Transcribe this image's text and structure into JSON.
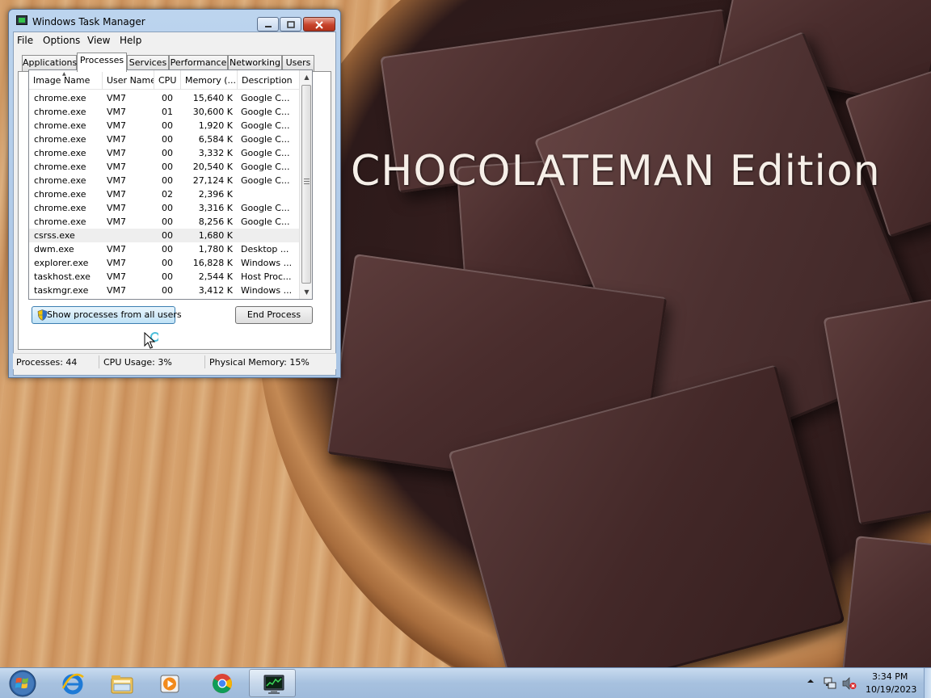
{
  "wallpaper": {
    "title": "CHOCOLATEMAN Edition"
  },
  "window": {
    "title": "Windows Task Manager",
    "menus": [
      "File",
      "Options",
      "View",
      "Help"
    ],
    "tabs": [
      "Applications",
      "Processes",
      "Services",
      "Performance",
      "Networking",
      "Users"
    ],
    "active_tab": "Processes",
    "columns": [
      "Image Name",
      "User Name",
      "CPU",
      "Memory (...",
      "Description"
    ],
    "processes": [
      {
        "name": "chrome.exe",
        "user": "VM7",
        "cpu": "00",
        "mem": "15,640 K",
        "desc": "Google C..."
      },
      {
        "name": "chrome.exe",
        "user": "VM7",
        "cpu": "01",
        "mem": "30,600 K",
        "desc": "Google C..."
      },
      {
        "name": "chrome.exe",
        "user": "VM7",
        "cpu": "00",
        "mem": "1,920 K",
        "desc": "Google C..."
      },
      {
        "name": "chrome.exe",
        "user": "VM7",
        "cpu": "00",
        "mem": "6,584 K",
        "desc": "Google C..."
      },
      {
        "name": "chrome.exe",
        "user": "VM7",
        "cpu": "00",
        "mem": "3,332 K",
        "desc": "Google C..."
      },
      {
        "name": "chrome.exe",
        "user": "VM7",
        "cpu": "00",
        "mem": "20,540 K",
        "desc": "Google C..."
      },
      {
        "name": "chrome.exe",
        "user": "VM7",
        "cpu": "00",
        "mem": "27,124 K",
        "desc": "Google C..."
      },
      {
        "name": "chrome.exe",
        "user": "VM7",
        "cpu": "02",
        "mem": "2,396 K",
        "desc": ""
      },
      {
        "name": "chrome.exe",
        "user": "VM7",
        "cpu": "00",
        "mem": "3,316 K",
        "desc": "Google C..."
      },
      {
        "name": "chrome.exe",
        "user": "VM7",
        "cpu": "00",
        "mem": "8,256 K",
        "desc": "Google C..."
      },
      {
        "name": "csrss.exe",
        "user": "",
        "cpu": "00",
        "mem": "1,680 K",
        "desc": ""
      },
      {
        "name": "dwm.exe",
        "user": "VM7",
        "cpu": "00",
        "mem": "1,780 K",
        "desc": "Desktop ..."
      },
      {
        "name": "explorer.exe",
        "user": "VM7",
        "cpu": "00",
        "mem": "16,828 K",
        "desc": "Windows ..."
      },
      {
        "name": "taskhost.exe",
        "user": "VM7",
        "cpu": "00",
        "mem": "2,544 K",
        "desc": "Host Proc..."
      },
      {
        "name": "taskmgr.exe",
        "user": "VM7",
        "cpu": "00",
        "mem": "3,412 K",
        "desc": "Windows ..."
      }
    ],
    "hover_row": 10,
    "buttons": {
      "show_all": "Show processes from all users",
      "end_process": "End Process"
    },
    "status": {
      "processes": "Processes: 44",
      "cpu": "CPU Usage: 3%",
      "memory": "Physical Memory: 15%"
    }
  },
  "taskbar": {
    "pinned": [
      {
        "name": "internet-explorer",
        "icon": "ie-icon"
      },
      {
        "name": "windows-explorer",
        "icon": "folder-icon"
      },
      {
        "name": "media-player",
        "icon": "media-player-icon"
      },
      {
        "name": "chrome",
        "icon": "chrome-icon"
      },
      {
        "name": "task-manager",
        "icon": "task-manager-icon"
      }
    ],
    "active_item": "task-manager",
    "clock": {
      "time": "3:34 PM",
      "date": "10/19/2023"
    }
  },
  "colors": {
    "accent": "#3c7fb1",
    "close": "#c7432b",
    "taskbar": "#a7c1df",
    "chocolate": "#4a2d2d"
  }
}
